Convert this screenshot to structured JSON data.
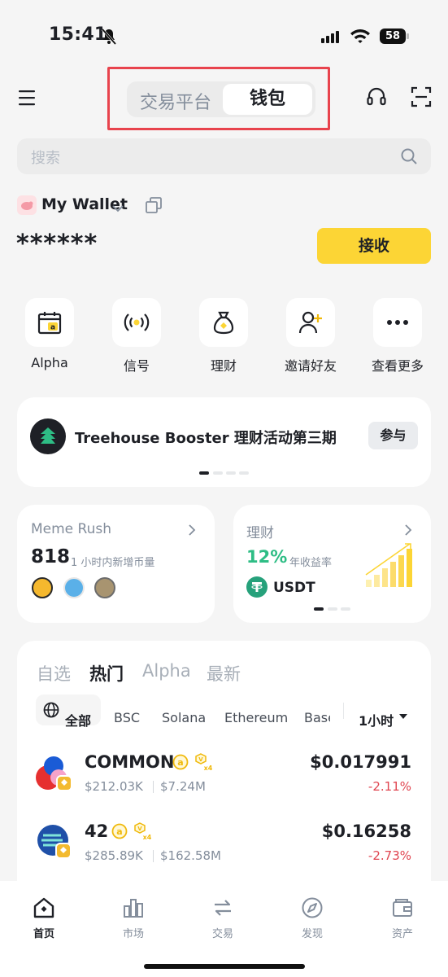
{
  "status_bar": {
    "time": "15:41",
    "battery": "58"
  },
  "header": {
    "segments": {
      "inactive": "交易平台",
      "active": "钱包"
    }
  },
  "search": {
    "placeholder": "搜索"
  },
  "wallet": {
    "name": "My Wallet",
    "balance_masked": "******",
    "receive_label": "接收"
  },
  "quick_actions": [
    {
      "label": "Alpha",
      "icon": "alpha-calendar-icon"
    },
    {
      "label": "信号",
      "icon": "signal-icon"
    },
    {
      "label": "理财",
      "icon": "money-bag-icon"
    },
    {
      "label": "邀请好友",
      "icon": "invite-friend-icon"
    },
    {
      "label": "查看更多",
      "icon": "more-icon"
    }
  ],
  "banner": {
    "title": "Treehouse Booster 理财活动第三期",
    "button": "参与",
    "page_index": 1,
    "page_count": 4
  },
  "meme_card": {
    "title": "Meme Rush",
    "count": "818",
    "count_caption": "1 小时内新增币量"
  },
  "earn_card": {
    "title": "理财",
    "apr": "12%",
    "apr_caption": "年收益率",
    "asset": "USDT",
    "page_index": 1,
    "page_count": 3
  },
  "market": {
    "tabs": [
      "自选",
      "热门",
      "Alpha",
      "最新"
    ],
    "active_tab": "热门",
    "chains": [
      "全部",
      "BSC",
      "Solana",
      "Ethereum",
      "Base"
    ],
    "active_chain": "全部",
    "timeframe": "1小时",
    "tokens": [
      {
        "name": "COMMON",
        "volume": "$212.03K",
        "market_cap": "$7.24M",
        "price": "$0.017991",
        "change": "-2.11%"
      },
      {
        "name": "42",
        "volume": "$285.89K",
        "market_cap": "$162.58M",
        "price": "$0.16258",
        "change": "-2.73%"
      }
    ]
  },
  "bottom_nav": {
    "items": [
      "首页",
      "市场",
      "交易",
      "发现",
      "资产"
    ],
    "active": "首页"
  },
  "colors": {
    "brand_yellow": "#FCD535",
    "positive_green": "#2EBD85",
    "negative_red": "#E04550",
    "highlight_red": "#E8434D"
  }
}
